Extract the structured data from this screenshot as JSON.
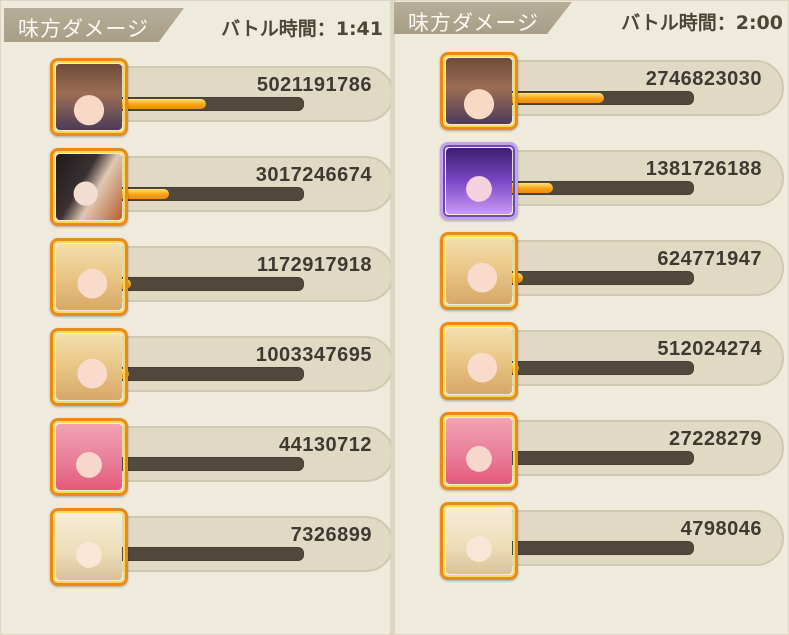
{
  "left": {
    "header": "味方ダメージ",
    "time": "バトル時間：1:41",
    "rows": [
      {
        "avatar": "a1",
        "damage": "5021191786",
        "ratio": 0.49
      },
      {
        "avatar": "a2",
        "damage": "3017246674",
        "ratio": 0.29
      },
      {
        "avatar": "a3",
        "damage": "1172917918",
        "ratio": 0.09
      },
      {
        "avatar": "a3",
        "damage": "1003347695",
        "ratio": 0.08
      },
      {
        "avatar": "a5",
        "damage": "44130712",
        "ratio": 0.0
      },
      {
        "avatar": "a6",
        "damage": "7326899",
        "ratio": 0.0
      }
    ]
  },
  "right": {
    "header": "味方ダメージ",
    "time": "バトル時間：2:00",
    "rows": [
      {
        "avatar": "a1",
        "damage": "2746823030",
        "ratio": 0.53
      },
      {
        "avatar": "a7",
        "damage": "1381726188",
        "ratio": 0.26
      },
      {
        "avatar": "a3",
        "damage": "624771947",
        "ratio": 0.1
      },
      {
        "avatar": "a3",
        "damage": "512024274",
        "ratio": 0.08
      },
      {
        "avatar": "a5",
        "damage": "27228279",
        "ratio": 0.0
      },
      {
        "avatar": "a6",
        "damage": "4798046",
        "ratio": 0.0
      }
    ]
  }
}
